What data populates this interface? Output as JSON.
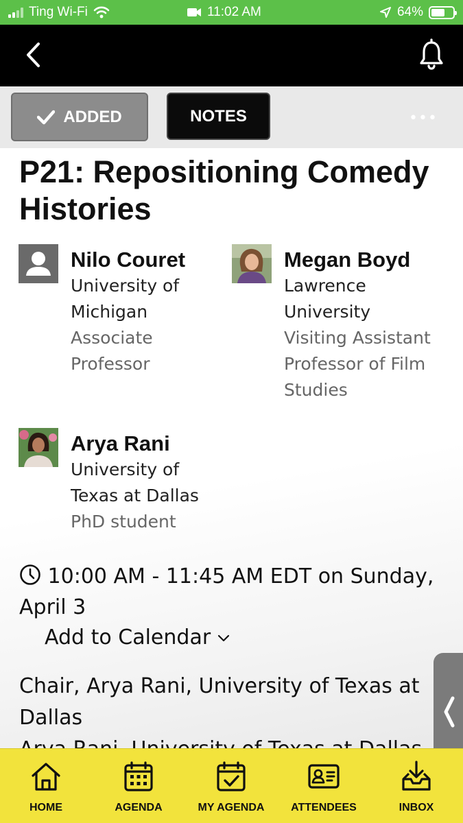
{
  "status_bar": {
    "carrier": "Ting Wi-Fi",
    "time": "11:02 AM",
    "battery": "64%",
    "battery_level": 0.64
  },
  "toolbar": {
    "added_label": "ADDED",
    "notes_label": "NOTES",
    "more_label": "•••"
  },
  "session": {
    "title": "P21: Repositioning Comedy Histories",
    "time_text": "10:00 AM - 11:45 AM EDT on Sunday, April 3",
    "add_to_calendar": "Add to Calendar",
    "description_line1": "Chair, Arya Rani, University of Texas at Dallas",
    "description_line2": "Arya Rani, University of Texas at Dallas"
  },
  "speakers": [
    {
      "name": "Nilo Couret",
      "org": "University of Michigan",
      "role": "Associate Professor"
    },
    {
      "name": "Megan Boyd",
      "org": "Lawrence University",
      "role": "Visiting Assistant Professor of Film Studies"
    },
    {
      "name": "Arya Rani",
      "org": "University of Texas at Dallas",
      "role": "PhD student"
    }
  ],
  "tabbar": {
    "items": [
      {
        "label": "HOME",
        "icon": "home-icon"
      },
      {
        "label": "AGENDA",
        "icon": "calendar-grid-icon"
      },
      {
        "label": "MY AGENDA",
        "icon": "calendar-check-icon"
      },
      {
        "label": "ATTENDEES",
        "icon": "id-card-icon"
      },
      {
        "label": "INBOX",
        "icon": "inbox-download-icon"
      }
    ]
  },
  "colors": {
    "status_bar": "#5cc049",
    "nav_bar": "#000000",
    "tab_bar": "#f2e33c",
    "added_button": "#8c8c8c"
  }
}
